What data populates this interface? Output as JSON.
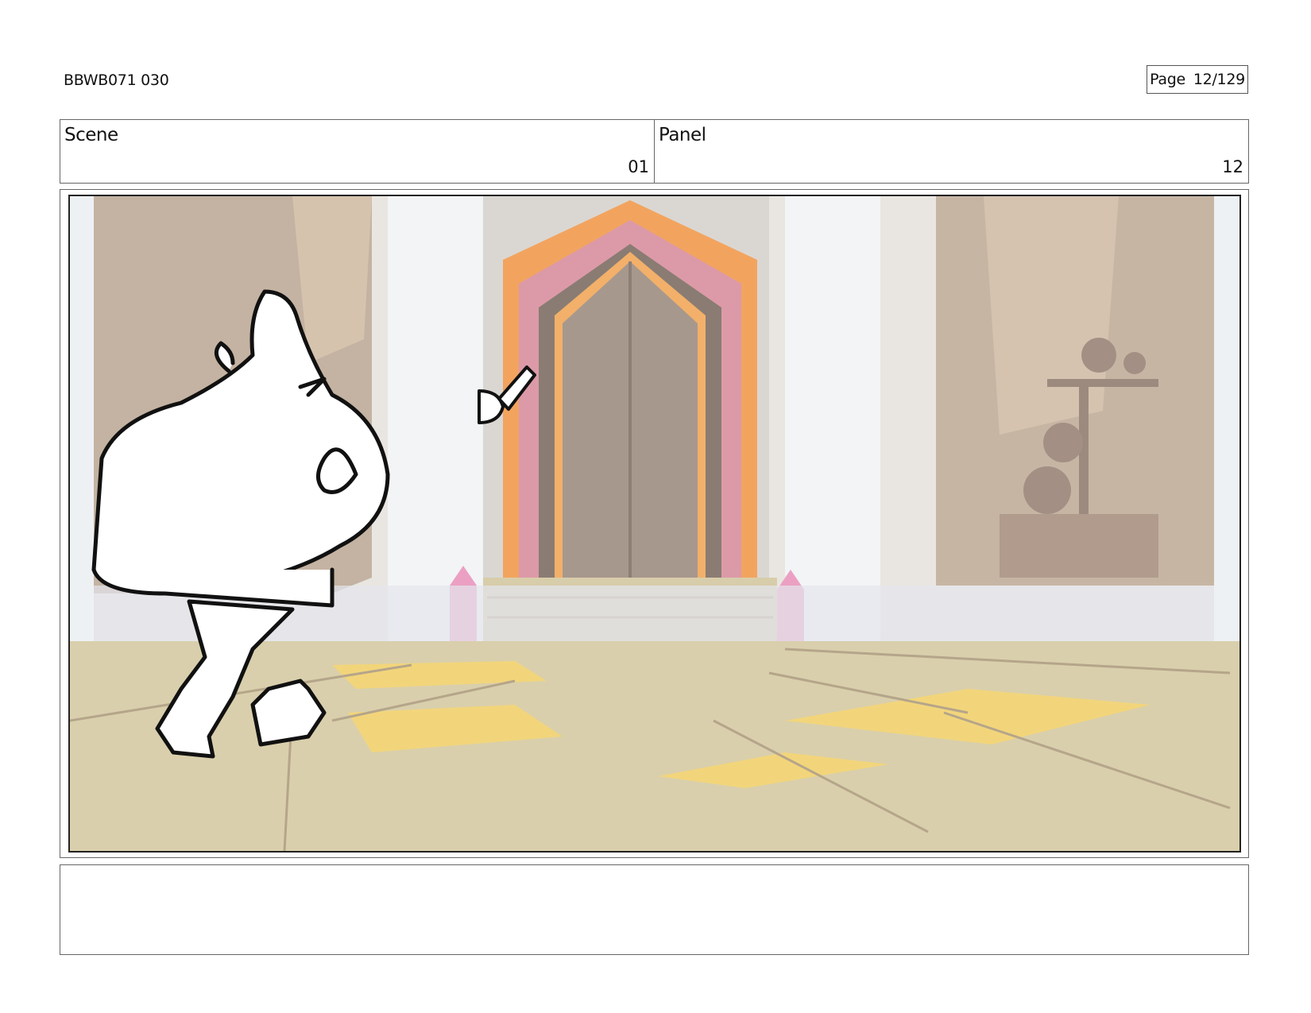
{
  "header": {
    "doc_id": "BBWB071 030",
    "page_label": "Page",
    "page_value": "12/129"
  },
  "info": {
    "scene_label": "Scene",
    "scene_value": "01",
    "panel_label": "Panel",
    "panel_value": "12"
  },
  "caption": {
    "text": ""
  },
  "colors": {
    "floor": "#d9cfac",
    "wall": "#c7b8a6",
    "pillar": "#eef1f3",
    "door": "#a8998d",
    "door_trim_pink": "#d99aa8",
    "door_trim_orange": "#f0a45e",
    "crystal": "#e89bbd",
    "light_patch": "#f3d47a"
  }
}
